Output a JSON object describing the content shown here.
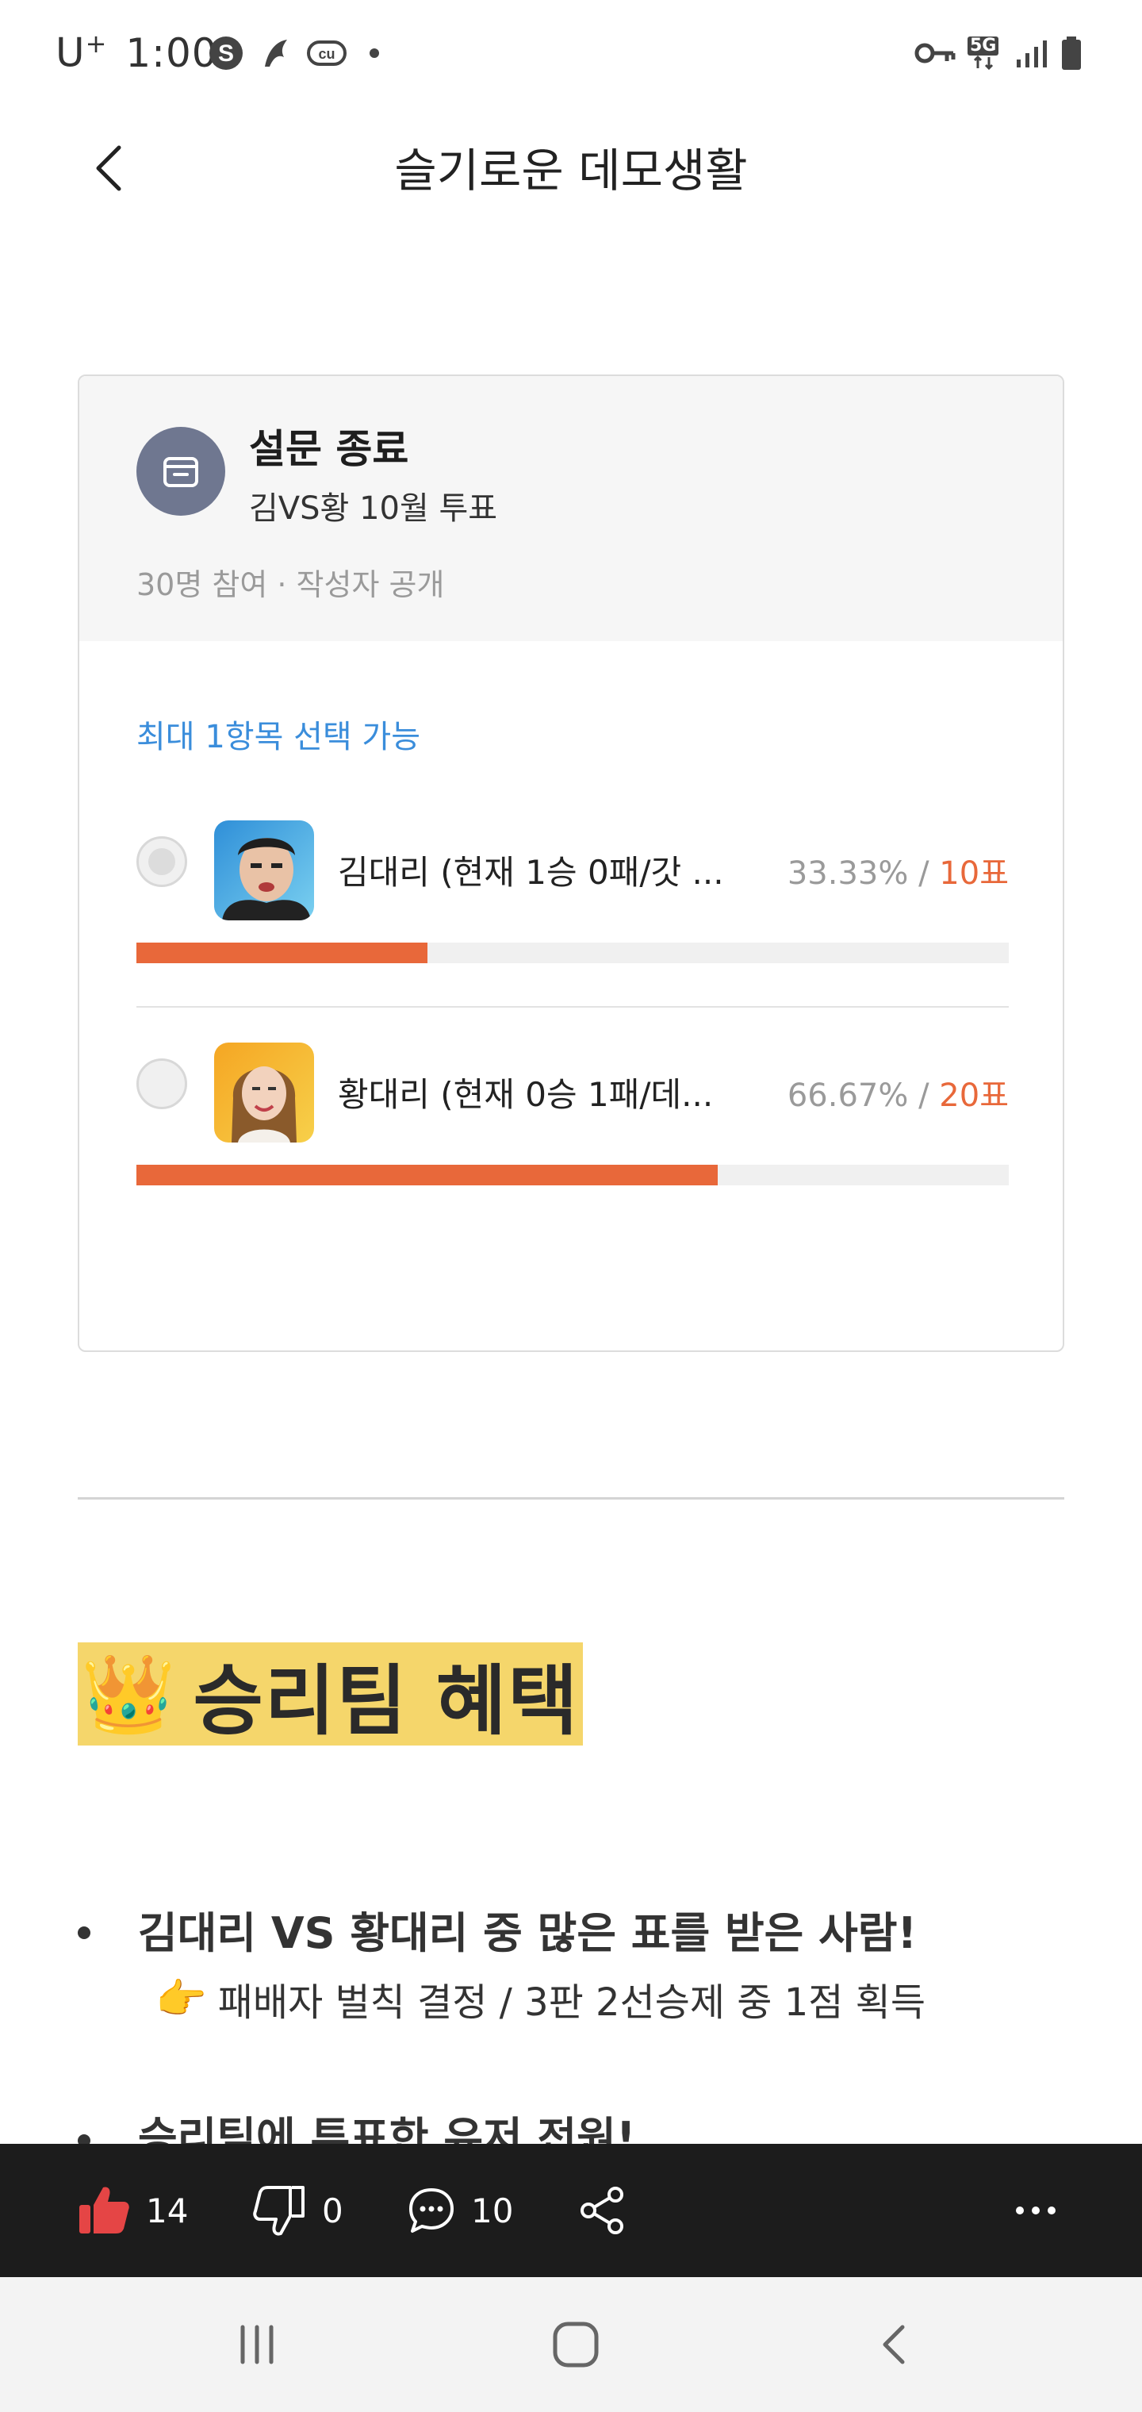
{
  "status_bar": {
    "carrier": "U",
    "carrier_plus": "+",
    "time": "1:00",
    "network": "5G"
  },
  "header": {
    "title": "슬기로운 데모생활"
  },
  "poll": {
    "status": "설문 종료",
    "subtitle": "김VS황 10월 투표",
    "meta": "30명 참여 · 작성자 공개",
    "hint": "최대 1항목 선택 가능",
    "options": [
      {
        "label": "김대리 (현재 1승 0패/갓 ...",
        "percent": "33.33% / ",
        "votes": "10표",
        "fraction": 0.3333
      },
      {
        "label": "황대리 (현재 0승 1패/데...",
        "percent": "66.67% / ",
        "votes": "20표",
        "fraction": 0.6667
      }
    ],
    "accent_color": "#e8683a"
  },
  "article": {
    "heading_emoji": "👑",
    "heading": "승리팀 혜택",
    "bullets": [
      {
        "text": "김대리 VS 황대리 중 많은 표를 받은 사람!",
        "sub_emoji": "👉",
        "sub": "패배자 벌칙 결정 / 3판 2선승제 중 1점 획득"
      },
      {
        "text": "승리팀에 투표한 유저 전원!"
      }
    ]
  },
  "actions": {
    "likes": "14",
    "dislikes": "0",
    "comments": "10"
  }
}
